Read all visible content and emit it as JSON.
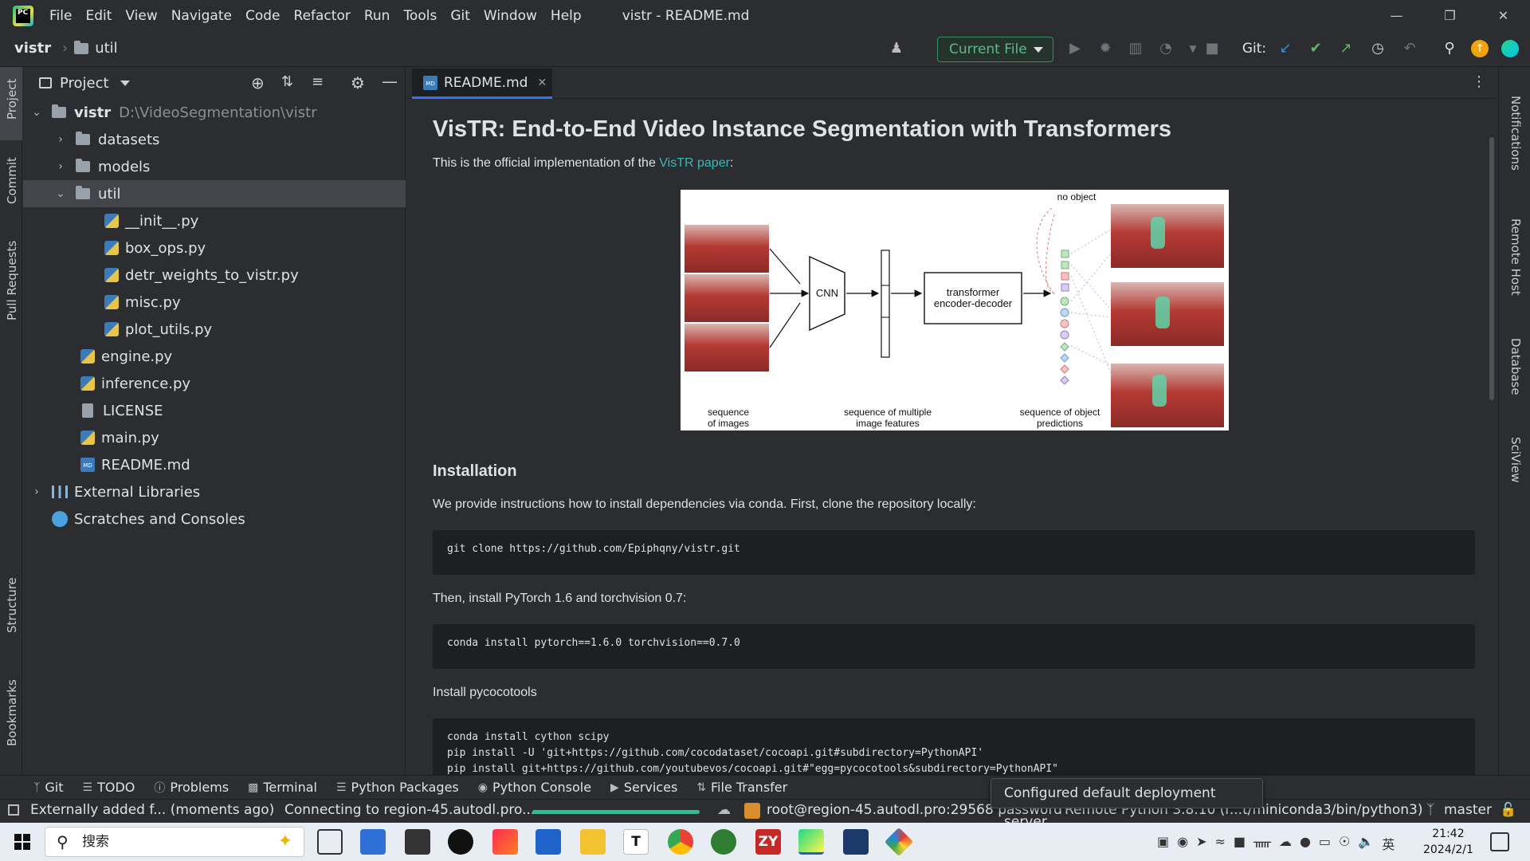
{
  "window": {
    "title": "vistr - README.md",
    "menu": [
      "File",
      "Edit",
      "View",
      "Navigate",
      "Code",
      "Refactor",
      "Run",
      "Tools",
      "Git",
      "Window",
      "Help"
    ]
  },
  "toolbar": {
    "project": "vistr",
    "folder": "util",
    "run_config": "Current File",
    "git_label": "Git:"
  },
  "left_strip": [
    "Project",
    "Commit",
    "Pull Requests",
    "Structure",
    "Bookmarks"
  ],
  "right_strip": [
    "Notifications",
    "Remote Host",
    "Database",
    "SciView"
  ],
  "project_panel": {
    "title": "Project",
    "tree": [
      {
        "label": "vistr",
        "path": "D:\\VideoSegmentation\\vistr",
        "type": "folder"
      },
      {
        "label": "datasets",
        "type": "folder"
      },
      {
        "label": "models",
        "type": "folder"
      },
      {
        "label": "util",
        "type": "folder"
      },
      {
        "label": "__init__.py",
        "type": "py"
      },
      {
        "label": "box_ops.py",
        "type": "py"
      },
      {
        "label": "detr_weights_to_vistr.py",
        "type": "py"
      },
      {
        "label": "misc.py",
        "type": "py"
      },
      {
        "label": "plot_utils.py",
        "type": "py"
      },
      {
        "label": "engine.py",
        "type": "py"
      },
      {
        "label": "inference.py",
        "type": "py"
      },
      {
        "label": "LICENSE",
        "type": "file"
      },
      {
        "label": "main.py",
        "type": "py"
      },
      {
        "label": "README.md",
        "type": "md"
      },
      {
        "label": "External Libraries",
        "type": "lib"
      },
      {
        "label": "Scratches and Consoles",
        "type": "scratch"
      }
    ]
  },
  "editor": {
    "tab": "README.md",
    "h1": "VisTR: End-to-End Video Instance Segmentation with Transformers",
    "intro": "This is the official implementation of the ",
    "intro_link": "VisTR paper",
    "intro_end": ":",
    "figure": {
      "no_object": "no object",
      "cnn": "CNN",
      "transformer": "transformer\nencoder-decoder",
      "cap1": "sequence\nof images",
      "cap2": "sequence of multiple\nimage features",
      "cap3": "sequence of object\npredictions"
    },
    "install_h": "Installation",
    "install_p": "We provide instructions how to install dependencies via conda. First, clone the repository locally:",
    "code1": "git clone https://github.com/Epiphqny/vistr.git",
    "p2": "Then, install PyTorch 1.6 and torchvision 0.7:",
    "code2": "conda install pytorch==1.6.0 torchvision==0.7.0",
    "p3": "Install pycocotools",
    "code3": [
      "conda install cython scipy",
      "pip install -U 'git+https://github.com/cocodataset/cocoapi.git#subdirectory=PythonAPI'",
      "pip install git+https://github.com/youtubevos/cocoapi.git#\"egg=pycocotools&subdirectory=PythonAPI\""
    ]
  },
  "bottom_tools": [
    "Git",
    "TODO",
    "Problems",
    "Terminal",
    "Python Packages",
    "Python Console",
    "Services",
    "File Transfer"
  ],
  "status": {
    "left": "Externally added f... (moments ago)",
    "connecting": "Connecting to region-45.autodl.pro...",
    "progress": 1.0,
    "remote": "root@region-45.autodl.pro:29568 password",
    "interpreter": "Remote Python 3.8.10 (r...t/miniconda3/bin/python3)",
    "branch": "master",
    "popup": "Configured default deployment server"
  },
  "taskbar": {
    "search_placeholder": "搜索",
    "time": "21:42",
    "date": "2024/2/1",
    "ime": "英"
  }
}
